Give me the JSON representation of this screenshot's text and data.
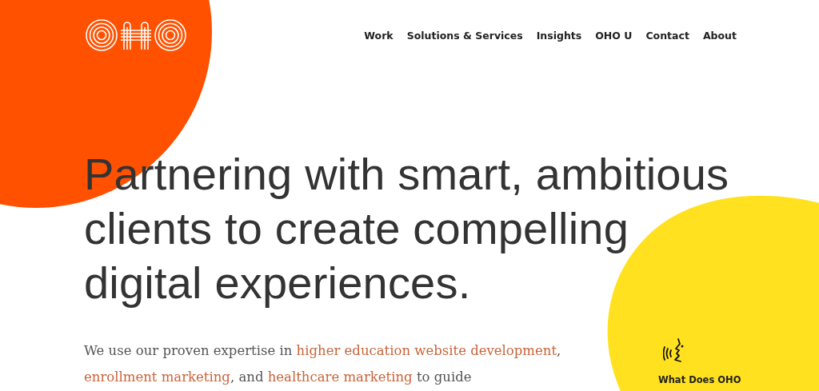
{
  "nav": {
    "items": [
      {
        "label": "Work"
      },
      {
        "label": "Solutions & Services"
      },
      {
        "label": "Insights"
      },
      {
        "label": "OHO U"
      },
      {
        "label": "Contact"
      },
      {
        "label": "About"
      }
    ]
  },
  "hero": {
    "headline": "Partnering with smart, ambitious clients to create compelling digital experiences.",
    "intro": [
      {
        "kind": "text",
        "text": "We use our proven expertise in "
      },
      {
        "kind": "link",
        "text": "higher education website development"
      },
      {
        "kind": "text",
        "text": ", "
      },
      {
        "kind": "link",
        "text": "enrollment marketing"
      },
      {
        "kind": "text",
        "text": ", and "
      },
      {
        "kind": "link",
        "text": "healthcare marketing"
      },
      {
        "kind": "text",
        "text": " to guide"
      }
    ]
  },
  "teaser": {
    "label": "What Does OHO"
  }
}
